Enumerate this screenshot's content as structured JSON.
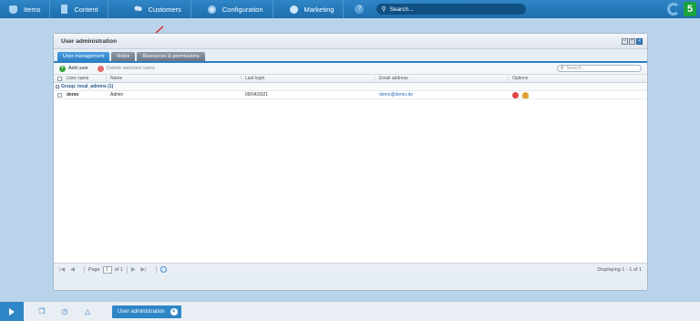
{
  "topnav": {
    "items": [
      {
        "label": "Items",
        "icon": "items-icon"
      },
      {
        "label": "Content",
        "icon": "content-icon"
      },
      {
        "label": "Customers",
        "icon": "customers-icon"
      },
      {
        "label": "Configuration",
        "icon": "configuration-icon"
      },
      {
        "label": "Marketing",
        "icon": "marketing-icon"
      }
    ],
    "help_label": "?",
    "search_placeholder": "Search..."
  },
  "window": {
    "title": "User administration",
    "tabs": [
      {
        "label": "User management",
        "active": true
      },
      {
        "label": "Roles",
        "active": false
      },
      {
        "label": "Resources & permissions",
        "active": false
      }
    ],
    "toolbar": {
      "add_user_label": "Add user",
      "delete_label": "Delete selected users",
      "search_placeholder": "Search..."
    },
    "grid": {
      "columns": [
        "User name",
        "Name",
        "Last login",
        "Email address",
        "Options"
      ],
      "group_label": "Group: local_admins (1)",
      "rows": [
        {
          "username": "demo",
          "name": "Admin",
          "last_login": "09/04/2021",
          "email": "demo@demo.de"
        }
      ]
    },
    "pager": {
      "page_label": "Page",
      "current_page": "1",
      "of_label": "of 1",
      "info": "Displaying 1 - 1 of 1"
    }
  },
  "taskbar": {
    "task_label": "User administration"
  },
  "colors": {
    "accent": "#2f86c6",
    "highlight": "#e02020"
  }
}
